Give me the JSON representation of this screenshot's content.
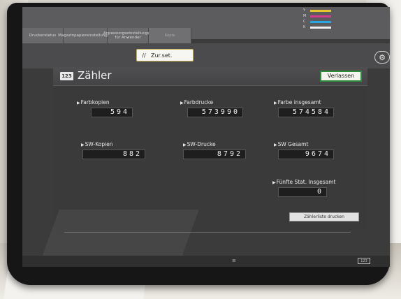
{
  "status_tabs": [
    "Druckerstatus",
    "Magazinpapiereinstellungen",
    "Anpassungseinstellungen für Anwender",
    "Kopie"
  ],
  "toner": [
    {
      "label": "Y",
      "color": "#e8c631"
    },
    {
      "label": "M",
      "color": "#d23a8b"
    },
    {
      "label": "C",
      "color": "#2aa7e0"
    },
    {
      "label": "K",
      "color": "#f0f0f0"
    }
  ],
  "reset_label": "Zur.set.",
  "window": {
    "icon_text": "123",
    "title": "Zähler",
    "exit_label": "Verlassen"
  },
  "counters": {
    "farbkopien": {
      "label": "Farbkopien",
      "value": "594"
    },
    "farbdrucke": {
      "label": "Farbdrucke",
      "value": "573990"
    },
    "farbe_gesamt": {
      "label": "Farbe insgesamt",
      "value": "574584"
    },
    "sw_kopien": {
      "label": "SW-Kopien",
      "value": "882"
    },
    "sw_drucke": {
      "label": "SW-Drucke",
      "value": "8792"
    },
    "sw_gesamt": {
      "label": "SW Gesamt",
      "value": "9674"
    },
    "fuenfte": {
      "label": "Fünfte Stat. Insgesamt",
      "value": "0"
    }
  },
  "print_list_label": "Zählerliste drucken",
  "page_indicator": "123",
  "colors": {
    "accent_green": "#2f8a3d",
    "reset_border": "#c8b04a"
  }
}
